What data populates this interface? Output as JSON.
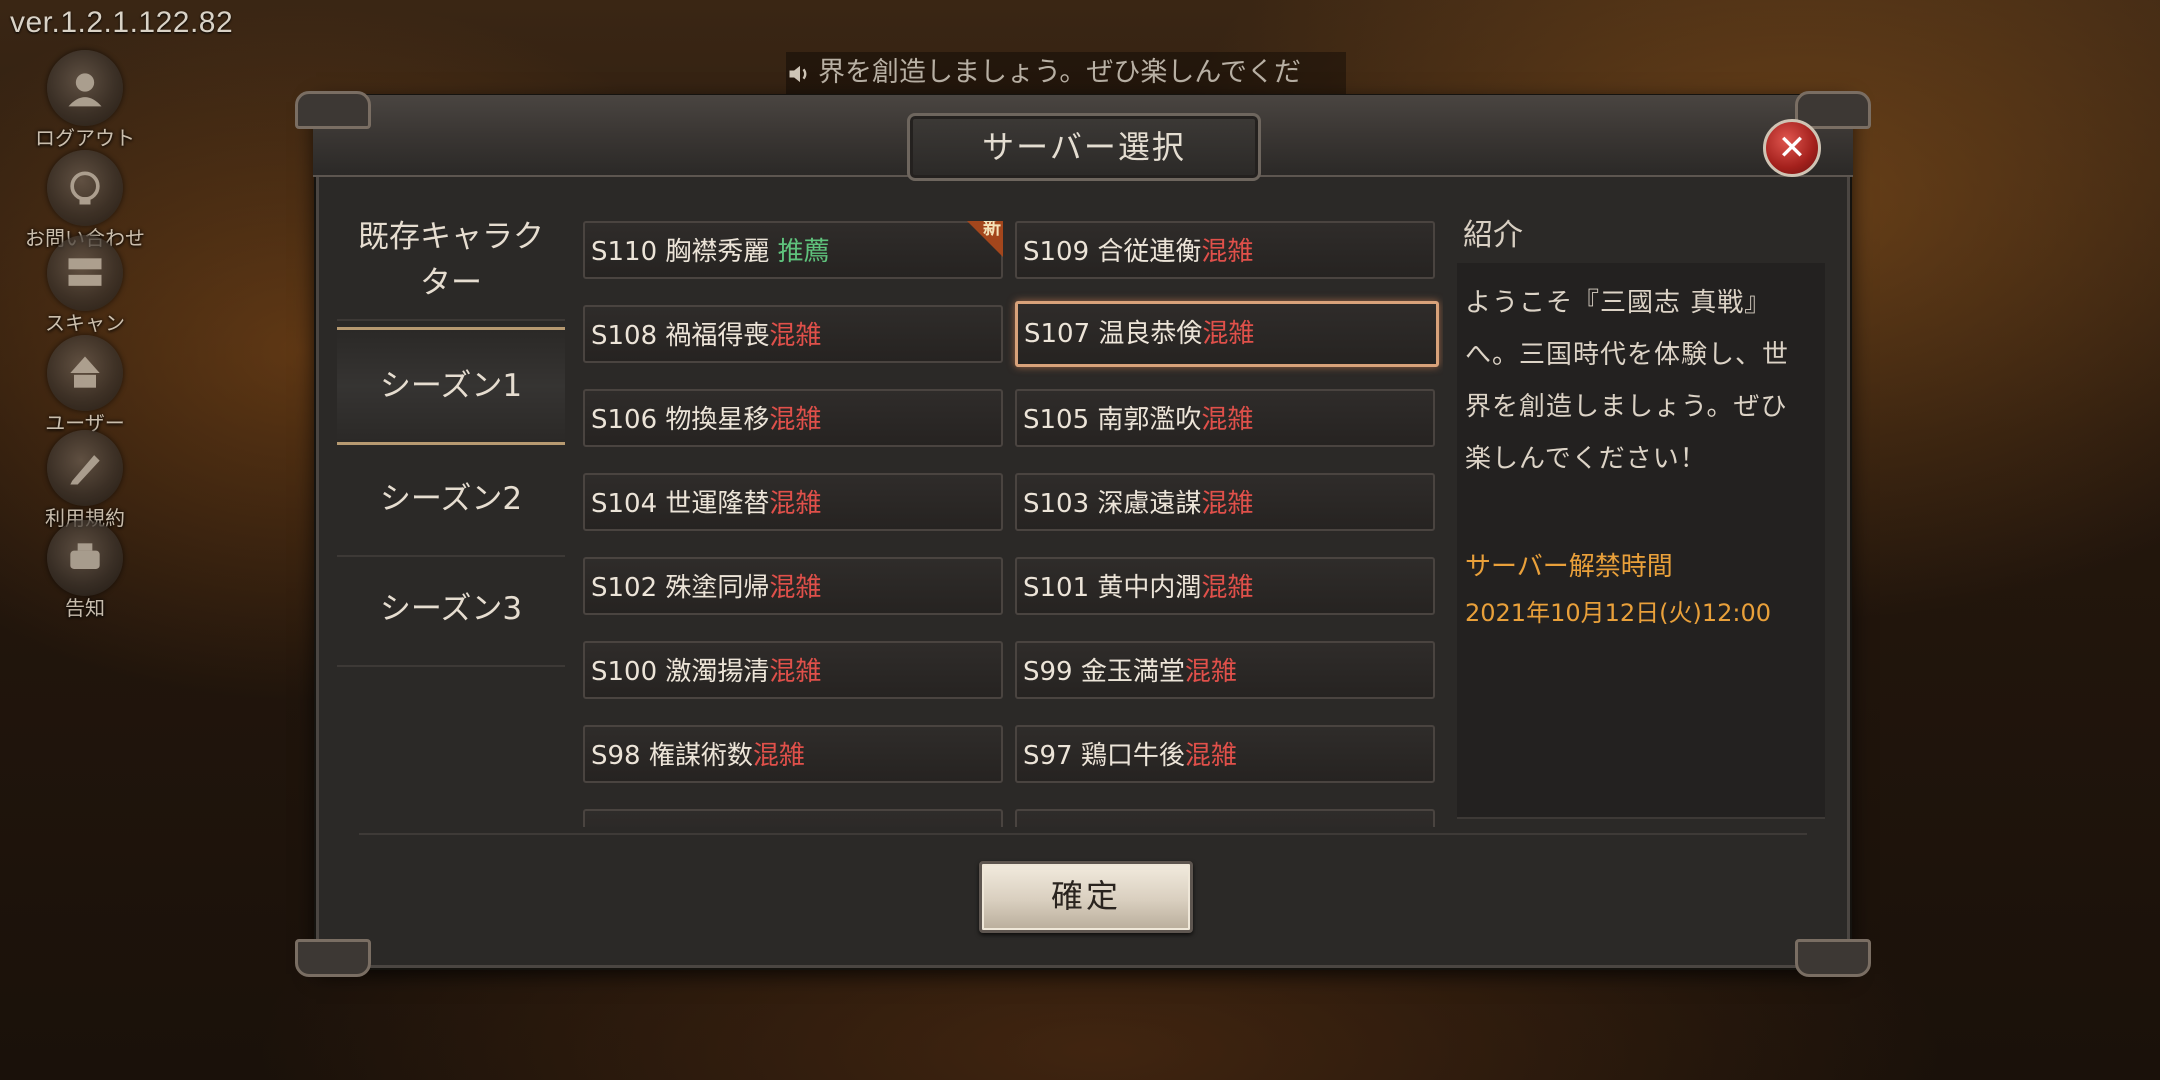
{
  "version": "ver.1.2.1.122.82",
  "side_menu": [
    {
      "label": "ログアウト",
      "icon": "user-portrait-icon"
    },
    {
      "label": "お問い合わせ",
      "icon": "support-icon"
    },
    {
      "label": "スキャン",
      "icon": "scan-icon"
    },
    {
      "label": "ユーザー",
      "icon": "user-icon"
    },
    {
      "label": "利用規約",
      "icon": "terms-icon"
    },
    {
      "label": "告知",
      "icon": "notice-icon"
    }
  ],
  "ticker": {
    "text": "界を創造しましょう。ぜひ楽しんでくだ",
    "icon": "speaker-icon"
  },
  "dialog": {
    "title": "サーバー選択",
    "close_icon": "close-icon",
    "confirm_label": "確定"
  },
  "tabs": [
    {
      "label": "既存キャラクター",
      "active": false
    },
    {
      "label": "シーズン1",
      "active": true
    },
    {
      "label": "シーズン2",
      "active": false
    },
    {
      "label": "シーズン3",
      "active": false
    }
  ],
  "servers": [
    {
      "name": "S110 胸襟秀麗 ",
      "status": "推薦",
      "status_type": "recommend",
      "new": true,
      "new_label": "新",
      "selected": false
    },
    {
      "name": "S109 合従連衡",
      "status": "混雑",
      "status_type": "crowded",
      "new": false,
      "selected": false
    },
    {
      "name": "S108 禍福得喪",
      "status": "混雑",
      "status_type": "crowded",
      "new": false,
      "selected": false
    },
    {
      "name": "S107 温良恭倹",
      "status": "混雑",
      "status_type": "crowded",
      "new": false,
      "selected": true
    },
    {
      "name": "S106 物換星移",
      "status": "混雑",
      "status_type": "crowded",
      "new": false,
      "selected": false
    },
    {
      "name": "S105 南郭濫吹",
      "status": "混雑",
      "status_type": "crowded",
      "new": false,
      "selected": false
    },
    {
      "name": "S104 世運隆替",
      "status": "混雑",
      "status_type": "crowded",
      "new": false,
      "selected": false
    },
    {
      "name": "S103 深慮遠謀",
      "status": "混雑",
      "status_type": "crowded",
      "new": false,
      "selected": false
    },
    {
      "name": "S102 殊塗同帰",
      "status": "混雑",
      "status_type": "crowded",
      "new": false,
      "selected": false
    },
    {
      "name": "S101 黄中内潤",
      "status": "混雑",
      "status_type": "crowded",
      "new": false,
      "selected": false
    },
    {
      "name": "S100 激濁揚清",
      "status": "混雑",
      "status_type": "crowded",
      "new": false,
      "selected": false
    },
    {
      "name": "S99 金玉満堂",
      "status": "混雑",
      "status_type": "crowded",
      "new": false,
      "selected": false
    },
    {
      "name": "S98 権謀術数",
      "status": "混雑",
      "status_type": "crowded",
      "new": false,
      "selected": false
    },
    {
      "name": "S97 鶏口牛後",
      "status": "混雑",
      "status_type": "crowded",
      "new": false,
      "selected": false
    }
  ],
  "intro": {
    "heading": "紹介",
    "lines": [
      "ようこそ『三國志 真戦』",
      "へ。三国時代を体験し、世",
      "界を創造しましょう。ぜひ",
      "楽しんでください！"
    ],
    "unlock_label": "サーバー解禁時間",
    "unlock_time": "2021年10月12日(火)12:00"
  }
}
